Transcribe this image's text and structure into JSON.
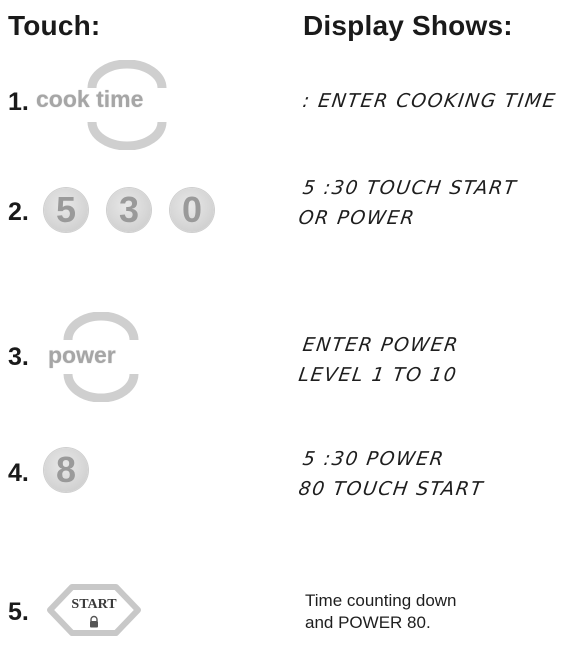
{
  "headers": {
    "touch": "Touch:",
    "display": "Display Shows:"
  },
  "steps": [
    {
      "number": "1.",
      "key": {
        "type": "pad",
        "label": "cook time"
      },
      "display": {
        "style": "lcd",
        "lines": [
          ": ENTER COOKING TIME"
        ]
      }
    },
    {
      "number": "2.",
      "key": {
        "type": "digits",
        "digits": [
          "5",
          "3",
          "0"
        ]
      },
      "display": {
        "style": "lcd",
        "lines": [
          "5 :30 TOUCH START",
          "OR POWER"
        ]
      }
    },
    {
      "number": "3.",
      "key": {
        "type": "pad",
        "label": "power"
      },
      "display": {
        "style": "lcd",
        "lines": [
          "ENTER POWER",
          "LEVEL 1 TO 10"
        ]
      }
    },
    {
      "number": "4.",
      "key": {
        "type": "digits",
        "digits": [
          "8"
        ]
      },
      "display": {
        "style": "lcd",
        "lines": [
          "5 :30 POWER",
          "80 TOUCH START"
        ]
      }
    },
    {
      "number": "5.",
      "key": {
        "type": "start",
        "label": "START",
        "icon": "lock-icon"
      },
      "display": {
        "style": "plain",
        "lines": [
          "Time counting down",
          "and POWER 80."
        ]
      }
    }
  ],
  "colors": {
    "key_gray": "#a6a6a6",
    "pad_fill": "#d7d7d7"
  }
}
